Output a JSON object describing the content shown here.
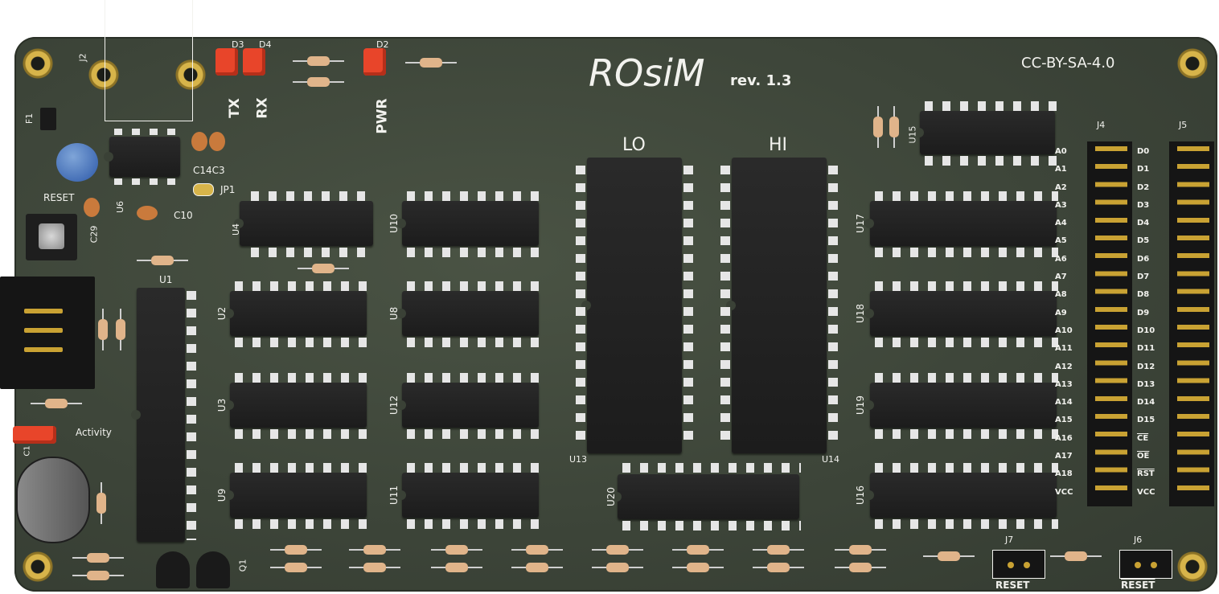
{
  "board": {
    "title": "ROsiM",
    "revision": "rev. 1.3",
    "license": "CC-BY-SA-4.0"
  },
  "chip_labels": {
    "lo": "LO",
    "hi": "HI"
  },
  "refs": {
    "J2": "J2",
    "D3": "D3",
    "D4": "D4",
    "D2": "D2",
    "F1": "F1",
    "C14C3": "C14C3",
    "JP1": "JP1",
    "C10": "C10",
    "U6": "U6",
    "C29": "C29",
    "U1": "U1",
    "U2": "U2",
    "U3": "U3",
    "U9": "U9",
    "U8": "U8",
    "U10": "U10",
    "U12": "U12",
    "U11": "U11",
    "U13": "U13",
    "U14": "U14",
    "U20": "U20",
    "U15": "U15",
    "U17": "U17",
    "U18": "U18",
    "U19": "U19",
    "U16": "U16",
    "J4": "J4",
    "J5": "J5",
    "J7": "J7",
    "J6": "J6",
    "Q1": "Q1",
    "C1": "C1",
    "U4": "U4"
  },
  "led_labels": {
    "tx": "TX",
    "rx": "RX",
    "pwr": "PWR",
    "activity": "Activity"
  },
  "reset_button_label": "RESET",
  "j7_label": "RESET",
  "j6_label": "RESET",
  "address_labels": [
    "A0",
    "A1",
    "A2",
    "A3",
    "A4",
    "A5",
    "A6",
    "A7",
    "A8",
    "A9",
    "A10",
    "A11",
    "A12",
    "A13",
    "A14",
    "A15",
    "A16",
    "A17",
    "A18",
    "VCC"
  ],
  "data_labels": [
    "D0",
    "D1",
    "D2",
    "D3",
    "D4",
    "D5",
    "D6",
    "D7",
    "D8",
    "D9",
    "D10",
    "D11",
    "D12",
    "D13",
    "D14",
    "D15",
    "CE",
    "OE",
    "RST",
    "VCC"
  ]
}
